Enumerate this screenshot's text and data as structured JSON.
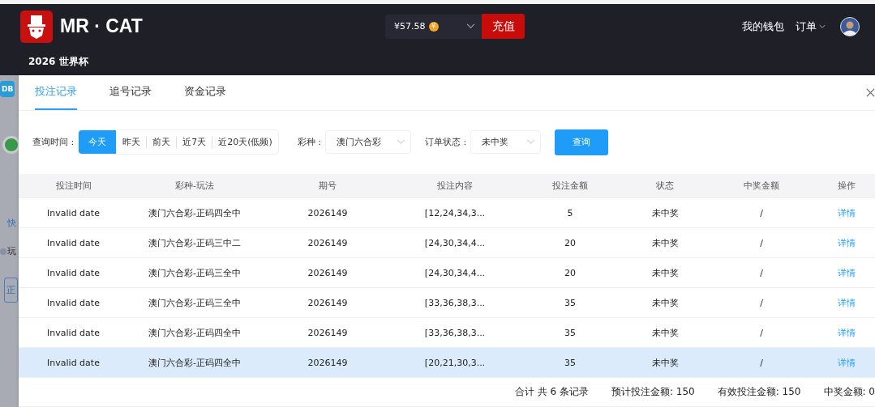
{
  "header": {
    "brand": "MR · CAT",
    "balance": "¥57.58",
    "coin": "¥",
    "recharge": "充值",
    "wallet": "我的钱包",
    "orders": "订单",
    "subnav": "2026 世界杯"
  },
  "backdrop": [
    {
      "kind": "db",
      "text": "DB"
    },
    {
      "kind": "ball"
    },
    {
      "kind": "link",
      "text": "快"
    },
    {
      "kind": "help",
      "text": "玩"
    },
    {
      "kind": "boxed",
      "text": "正"
    }
  ],
  "tabs": [
    {
      "label": "投注记录",
      "selected": true
    },
    {
      "label": "追号记录",
      "selected": false
    },
    {
      "label": "资金记录",
      "selected": false
    }
  ],
  "filters": {
    "time_label": "查询时间 :",
    "ranges": [
      {
        "label": "今天",
        "selected": true
      },
      {
        "label": "昨天",
        "selected": false
      },
      {
        "label": "前天",
        "selected": false
      },
      {
        "label": "近7天",
        "selected": false
      },
      {
        "label": "近20天(低频)",
        "selected": false
      }
    ],
    "lottery_label": "彩种 :",
    "lottery": "澳门六合彩",
    "status_label": "订单状态 :",
    "status": "未中奖",
    "query": "查询"
  },
  "table": {
    "columns": [
      "投注时间",
      "彩种-玩法",
      "期号",
      "投注内容",
      "投注金额",
      "状态",
      "中奖金额",
      "操作"
    ],
    "rows": [
      {
        "cells": [
          "Invalid date",
          "澳门六合彩-正码四全中",
          "2026149",
          "[12,24,34,3...",
          "5",
          "未中奖",
          "/",
          "详情"
        ],
        "hovered": false
      },
      {
        "cells": [
          "Invalid date",
          "澳门六合彩-正码三中二",
          "2026149",
          "[24,30,34,4...",
          "20",
          "未中奖",
          "/",
          "详情"
        ],
        "hovered": false
      },
      {
        "cells": [
          "Invalid date",
          "澳门六合彩-正码三全中",
          "2026149",
          "[24,30,34,4...",
          "20",
          "未中奖",
          "/",
          "详情"
        ],
        "hovered": false
      },
      {
        "cells": [
          "Invalid date",
          "澳门六合彩-正码三全中",
          "2026149",
          "[33,36,38,3...",
          "35",
          "未中奖",
          "/",
          "详情"
        ],
        "hovered": false
      },
      {
        "cells": [
          "Invalid date",
          "澳门六合彩-正码四全中",
          "2026149",
          "[33,36,38,3...",
          "35",
          "未中奖",
          "/",
          "详情"
        ],
        "hovered": false
      },
      {
        "cells": [
          "Invalid date",
          "澳门六合彩-正码四全中",
          "2026149",
          "[20,21,30,3...",
          "35",
          "未中奖",
          "/",
          "详情"
        ],
        "hovered": true
      }
    ]
  },
  "summary": [
    "合计 共 6 条记录",
    "预计投注金额: 150",
    "有效投注金额: 150",
    "中奖金额: 0"
  ]
}
